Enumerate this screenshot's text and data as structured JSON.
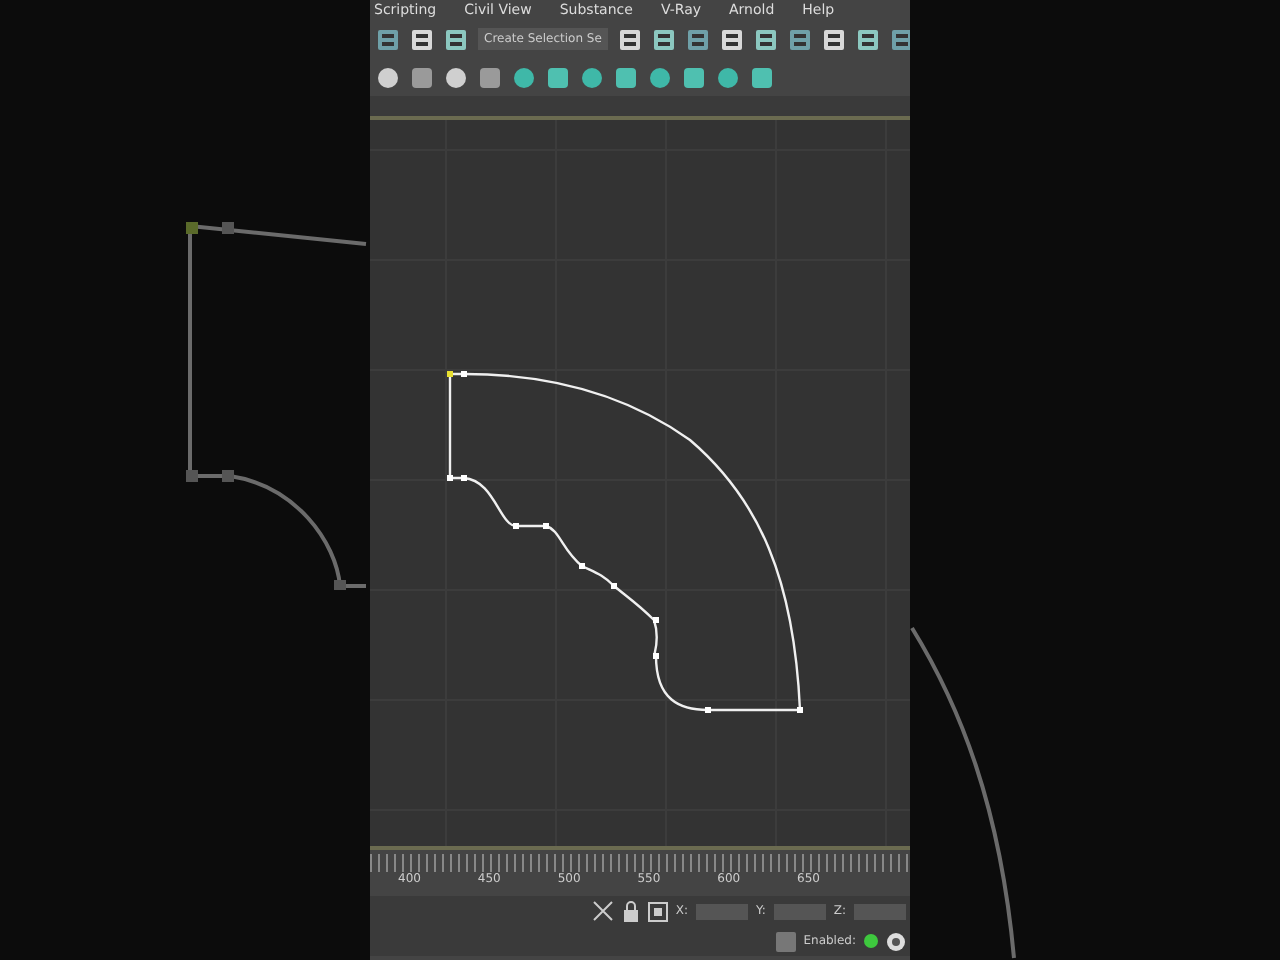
{
  "menu": [
    "Scripting",
    "Civil View",
    "Substance",
    "V-Ray",
    "Arnold",
    "Help"
  ],
  "toolbar": {
    "selection_set": "Create Selection Se"
  },
  "timeline": {
    "ticks": [
      "400",
      "450",
      "500",
      "550",
      "600",
      "650"
    ]
  },
  "status_bar": {
    "coordinates": [
      {
        "label": "X:"
      },
      {
        "label": "Y:"
      },
      {
        "label": "Z:"
      }
    ],
    "enabled_label": "Enabled:",
    "enabled": true
  }
}
